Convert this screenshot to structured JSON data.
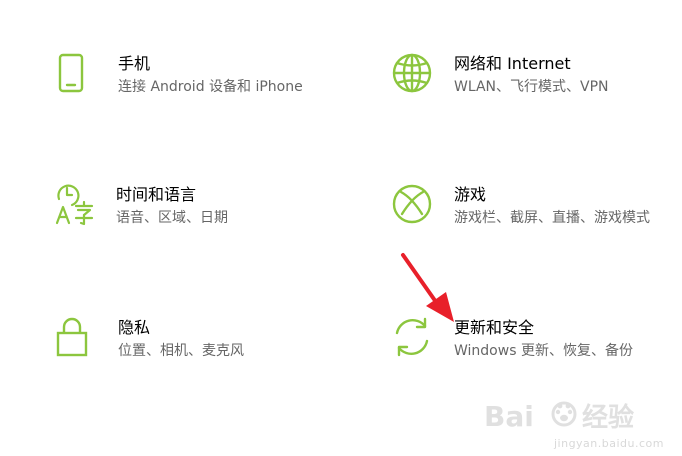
{
  "settings": {
    "accent_color": "#8cc63e",
    "tiles": [
      {
        "title": "手机",
        "description": "连接 Android 设备和 iPhone",
        "icon": "phone-icon"
      },
      {
        "title": "网络和 Internet",
        "description": "WLAN、飞行模式、VPN",
        "icon": "globe-icon"
      },
      {
        "title": "时间和语言",
        "description": "语音、区域、日期",
        "icon": "time-language-icon"
      },
      {
        "title": "游戏",
        "description": "游戏栏、截屏、直播、游戏模式",
        "icon": "xbox-icon"
      },
      {
        "title": "隐私",
        "description": "位置、相机、麦克风",
        "icon": "lock-icon"
      },
      {
        "title": "更新和安全",
        "description": "Windows 更新、恢复、备份",
        "icon": "sync-icon"
      }
    ]
  },
  "annotation": {
    "arrow_color": "#e8202a"
  },
  "watermark": {
    "logo_text": "Baidu 经验",
    "url": "jingyan.baidu.com"
  }
}
